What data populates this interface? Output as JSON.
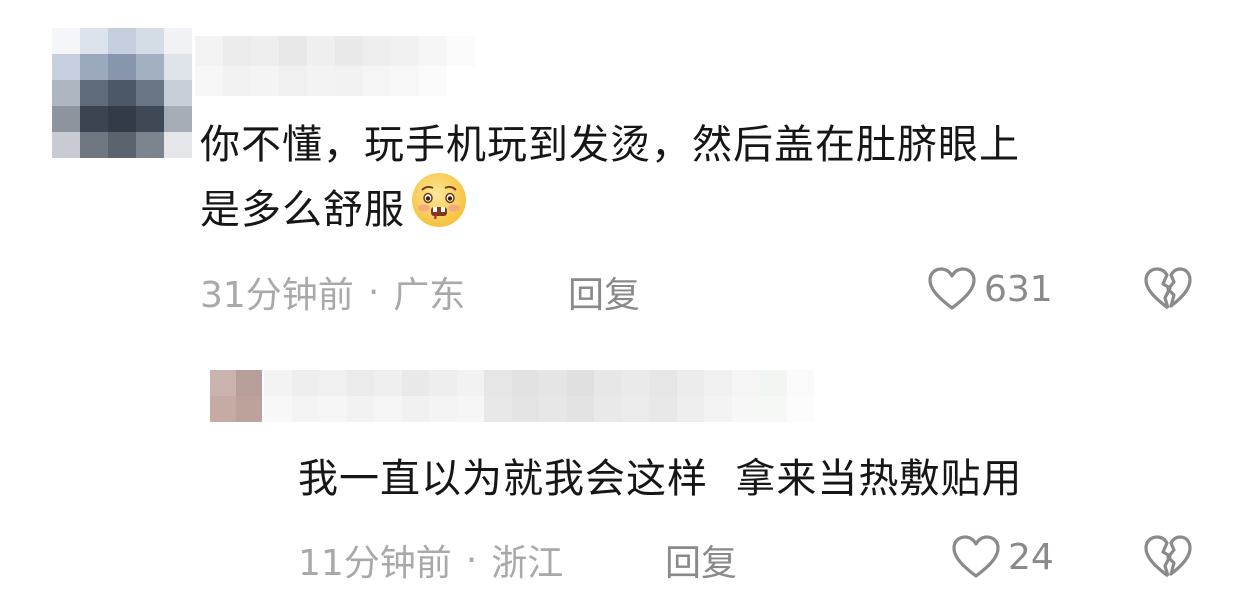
{
  "comments": [
    {
      "text_line1": "你不懂，玩手机玩到发烫，然后盖在肚脐眼上",
      "text_line2": "是多么舒服",
      "time": "31分钟前",
      "location": "广东",
      "reply_label": "回复",
      "like_count": "631",
      "emoji": "pleading-face-emoji"
    },
    {
      "text_line1": "我一直以为就我会这样  拿来当热敷贴用",
      "time": "11分钟前",
      "location": "浙江",
      "reply_label": "回复",
      "like_count": "24"
    }
  ],
  "separator": "·",
  "colors": {
    "text": "#161616",
    "meta": "#a9a9a9",
    "action": "#8a8a8a"
  }
}
